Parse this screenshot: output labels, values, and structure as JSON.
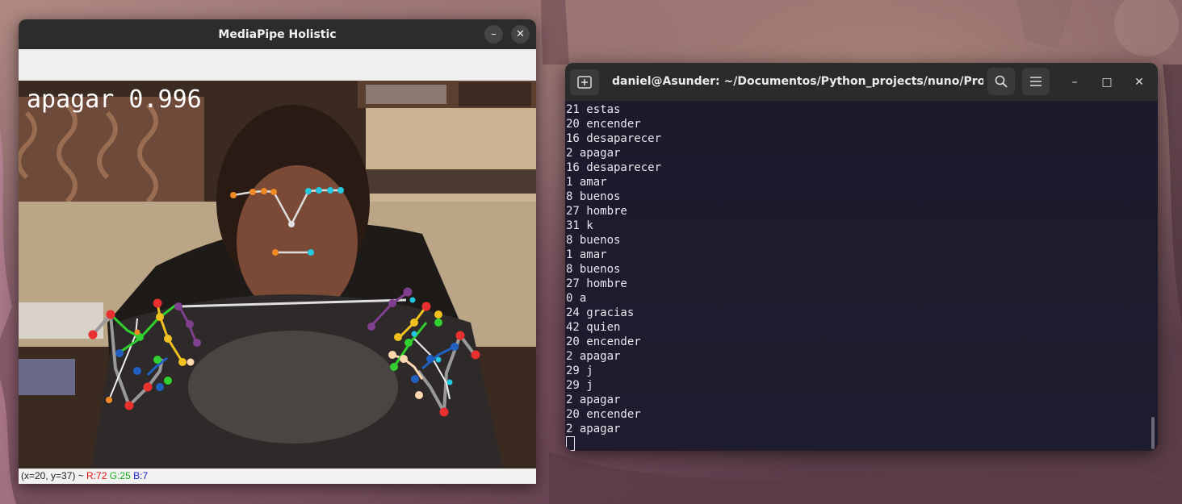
{
  "mediapipe_window": {
    "title": "MediaPipe Holistic",
    "minimize_glyph": "–",
    "close_glyph": "✕",
    "overlay_text": "apagar 0.996",
    "status_bar": {
      "coords": "(x=20, y=37) ~ ",
      "r": "R:72",
      "g": "G:25",
      "b": "B:7"
    }
  },
  "terminal_window": {
    "title": "daniel@Asunder: ~/Documentos/Python_projects/nuno/Pro...",
    "new_tab_icon": "new-tab-icon",
    "search_icon": "search-icon",
    "menu_icon": "hamburger-menu-icon",
    "minimize_glyph": "–",
    "maximize_glyph": "□",
    "close_glyph": "✕",
    "lines": [
      "21 estas",
      "20 encender",
      "16 desaparecer",
      "2 apagar",
      "16 desaparecer",
      "1 amar",
      "8 buenos",
      "27 hombre",
      "31 k",
      "8 buenos",
      "1 amar",
      "8 buenos",
      "27 hombre",
      "0 a",
      "24 gracias",
      "42 quien",
      "20 encender",
      "2 apagar",
      "29 j",
      "29 j",
      "2 apagar",
      "20 encender",
      "2 apagar"
    ]
  },
  "colors": {
    "terminal_bg": "#1c1a2b",
    "titlebar_bg": "#2c2c2c",
    "landmark_red": "#e83030",
    "landmark_orange": "#f08a24",
    "landmark_cyan": "#22c8e0",
    "landmark_green": "#30d030",
    "landmark_yellow": "#f0c020",
    "landmark_blue": "#2060c0",
    "landmark_purple": "#804090",
    "landmark_peach": "#ffd8b0"
  }
}
